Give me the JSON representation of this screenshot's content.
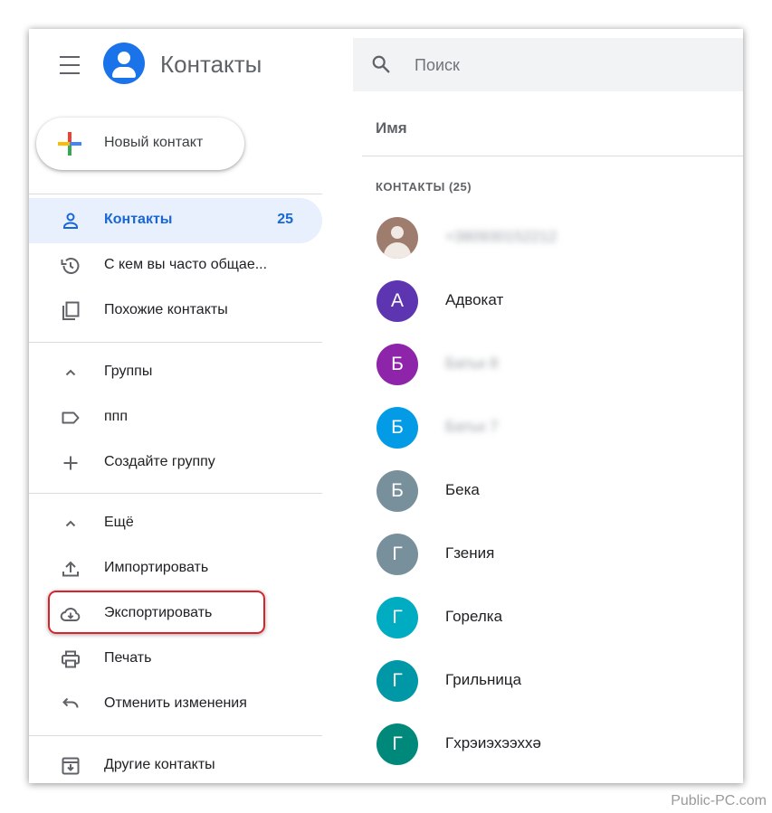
{
  "app": {
    "title": "Контакты"
  },
  "search": {
    "placeholder": "Поиск"
  },
  "new_contact": {
    "label": "Новый контакт"
  },
  "sidebar": {
    "items": [
      {
        "label": "Контакты",
        "count": "25",
        "icon": "person-icon"
      },
      {
        "label": "С кем вы часто общае...",
        "icon": "history-icon"
      },
      {
        "label": "Похожие контакты",
        "icon": "copy-icon"
      },
      {
        "label": "Группы",
        "icon": "chevron-up-icon"
      },
      {
        "label": "ппп",
        "icon": "label-icon"
      },
      {
        "label": "Создайте группу",
        "icon": "plus-icon"
      },
      {
        "label": "Ещё",
        "icon": "chevron-up-icon"
      },
      {
        "label": "Импортировать",
        "icon": "upload-icon"
      },
      {
        "label": "Экспортировать",
        "icon": "cloud-download-icon"
      },
      {
        "label": "Печать",
        "icon": "print-icon"
      },
      {
        "label": "Отменить изменения",
        "icon": "undo-icon"
      },
      {
        "label": "Другие контакты",
        "icon": "archive-icon"
      }
    ]
  },
  "list": {
    "column_header": "Имя",
    "section_label": "КОНТАКТЫ (25)",
    "contacts": [
      {
        "name": "+380930152212",
        "initial": "",
        "color": "#9e7d6e",
        "blurred": true
      },
      {
        "name": "Адвокат",
        "initial": "А",
        "color": "#5e35b1",
        "blurred": false
      },
      {
        "name": "Батьк 8",
        "initial": "Б",
        "color": "#8e24aa",
        "blurred": true
      },
      {
        "name": "Батьк 7",
        "initial": "Б",
        "color": "#039be5",
        "blurred": true
      },
      {
        "name": "Бека",
        "initial": "Б",
        "color": "#78909c",
        "blurred": false
      },
      {
        "name": "Гзения",
        "initial": "Г",
        "color": "#78909c",
        "blurred": false
      },
      {
        "name": "Горелка",
        "initial": "Г",
        "color": "#00acc1",
        "blurred": false
      },
      {
        "name": "Грильница",
        "initial": "Г",
        "color": "#0097a7",
        "blurred": false
      },
      {
        "name": "Гхрэиэхээххə",
        "initial": "Г",
        "color": "#00897b",
        "blurred": false
      }
    ]
  },
  "watermark": "Public-PC.com",
  "colors": {
    "accent": "#1a73e8",
    "active_bg": "#e8f0fe",
    "highlight": "#d9232a"
  }
}
